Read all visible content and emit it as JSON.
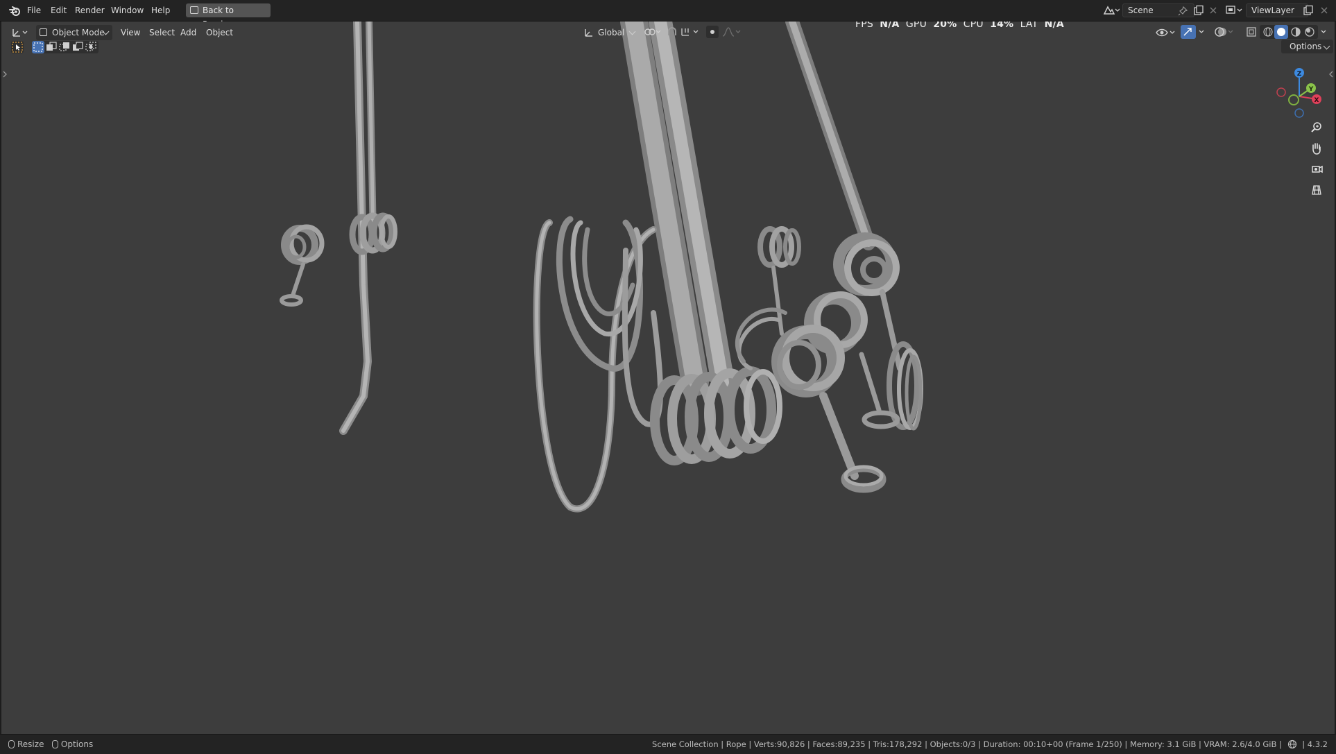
{
  "menu": {
    "items": [
      "File",
      "Edit",
      "Render",
      "Window",
      "Help"
    ],
    "back_button": "Back to Previous",
    "scene": "Scene",
    "view_layer": "ViewLayer"
  },
  "viewport_header": {
    "mode": "Object Mode",
    "menus": [
      "View",
      "Select",
      "Add",
      "Object"
    ],
    "orientation": "Global",
    "options": "Options"
  },
  "stats": {
    "fps_label": "FPS",
    "fps_value": "N/A",
    "gpu_label": "GPU",
    "gpu_value": "20%",
    "cpu_label": "CPU",
    "cpu_value": "14%",
    "lat_label": "LAT",
    "lat_value": "N/A"
  },
  "gizmo": {
    "z": "Z",
    "y": "Y",
    "x": "X"
  },
  "statusbar": {
    "resize": "Resize",
    "options": "Options",
    "info": "Scene Collection | Rope | Verts:90,826 | Faces:89,235 | Tris:178,292 | Objects:0/3 | Duration: 00:10+00 (Frame 1/250) | Memory: 3.1 GiB | VRAM: 2.6/4.0 GiB |",
    "version": "4.3.2"
  },
  "colors": {
    "viewport_bg": "#3d3d3d",
    "header_bg": "#232323",
    "axis_x": "#e0405a",
    "axis_y": "#8bc34a",
    "axis_z": "#3d8ae0",
    "active_tool": "#4772b3",
    "rope": "#a8a8a8"
  }
}
